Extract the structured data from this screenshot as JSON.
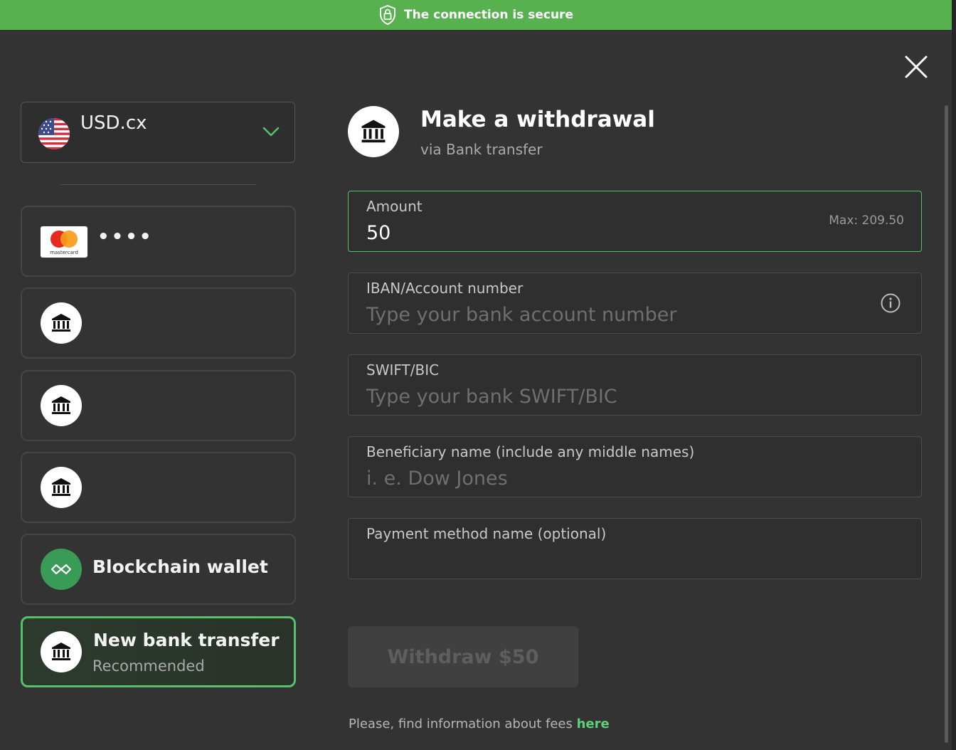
{
  "secure_bar": {
    "text": "The connection is secure",
    "icon": "lock-shield-icon"
  },
  "close": {
    "icon": "close-icon"
  },
  "currency": {
    "name": "USD.cx",
    "flag": "us-flag-icon",
    "chevron": "chevron-down-icon",
    "accent": "#57c06a"
  },
  "methods": [
    {
      "type": "card",
      "icon": "mastercard-logo",
      "logo_text": "mastercard",
      "label": "••••"
    },
    {
      "type": "bank",
      "icon": "bank-icon",
      "label": ""
    },
    {
      "type": "bank",
      "icon": "bank-icon",
      "label": ""
    },
    {
      "type": "bank",
      "icon": "bank-icon",
      "label": ""
    },
    {
      "type": "crypto",
      "icon": "blockchain-icon",
      "label": "Blockchain wallet"
    },
    {
      "type": "bank",
      "icon": "bank-icon",
      "label": "New bank transfer",
      "sublabel": "Recommended",
      "selected": true
    }
  ],
  "header": {
    "title": "Make a withdrawal",
    "subtitle": "via Bank transfer",
    "icon": "bank-icon"
  },
  "form": {
    "amount": {
      "label": "Amount",
      "value": "50",
      "max": "Max: 209.50"
    },
    "iban": {
      "label": "IBAN/Account number",
      "placeholder": "Type your bank account number",
      "icon": "info-icon"
    },
    "swift": {
      "label": "SWIFT/BIC",
      "placeholder": "Type your bank SWIFT/BIC"
    },
    "beneficiary": {
      "label": "Beneficiary name (include any middle names)",
      "placeholder": "i. e. Dow Jones"
    },
    "method_name": {
      "label": "Payment method name (optional)",
      "placeholder": ""
    }
  },
  "withdraw_button": {
    "label": "Withdraw $50",
    "disabled": true
  },
  "fees": {
    "text": "Please, find information about fees ",
    "link": "here"
  },
  "colors": {
    "secure_green": "#57b14f",
    "accent_green": "#57c06a",
    "link_green": "#5fd07a",
    "modal_bg": "#333333"
  }
}
